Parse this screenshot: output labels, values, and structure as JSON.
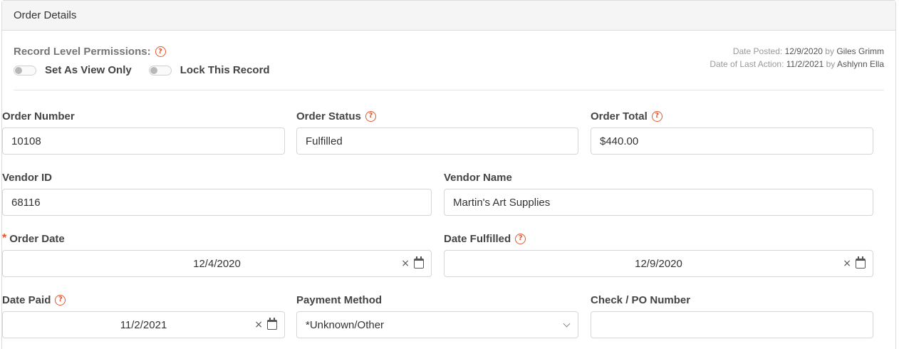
{
  "panel": {
    "title": "Order Details"
  },
  "permissions": {
    "label": "Record Level Permissions:",
    "view_only_label": "Set As View Only",
    "lock_label": "Lock This Record",
    "view_only_on": false,
    "lock_on": false
  },
  "meta": {
    "posted_prefix": "Date Posted:",
    "posted_date": "12/9/2020",
    "posted_by_word": "by",
    "posted_by": "Giles Grimm",
    "action_prefix": "Date of Last Action:",
    "action_date": "11/2/2021",
    "action_by_word": "by",
    "action_by": "Ashlynn Ella"
  },
  "fields": {
    "order_number": {
      "label": "Order Number",
      "value": "10108"
    },
    "order_status": {
      "label": "Order Status",
      "value": "Fulfilled"
    },
    "order_total": {
      "label": "Order Total",
      "value": "$440.00"
    },
    "vendor_id": {
      "label": "Vendor ID",
      "value": "68116"
    },
    "vendor_name": {
      "label": "Vendor Name",
      "value": "Martin's Art Supplies"
    },
    "order_date": {
      "label": "Order Date",
      "value": "12/4/2020",
      "required_mark": "*"
    },
    "date_fulfilled": {
      "label": "Date Fulfilled",
      "value": "12/9/2020"
    },
    "date_paid": {
      "label": "Date Paid",
      "value": "11/2/2021"
    },
    "payment_method": {
      "label": "Payment Method",
      "value": "*Unknown/Other"
    },
    "check_po_number": {
      "label": "Check / PO Number",
      "value": ""
    }
  },
  "icons": {
    "help": "?",
    "clear": "×"
  },
  "colors": {
    "accent": "#e8542c",
    "label": "#444444",
    "muted": "#999999"
  }
}
